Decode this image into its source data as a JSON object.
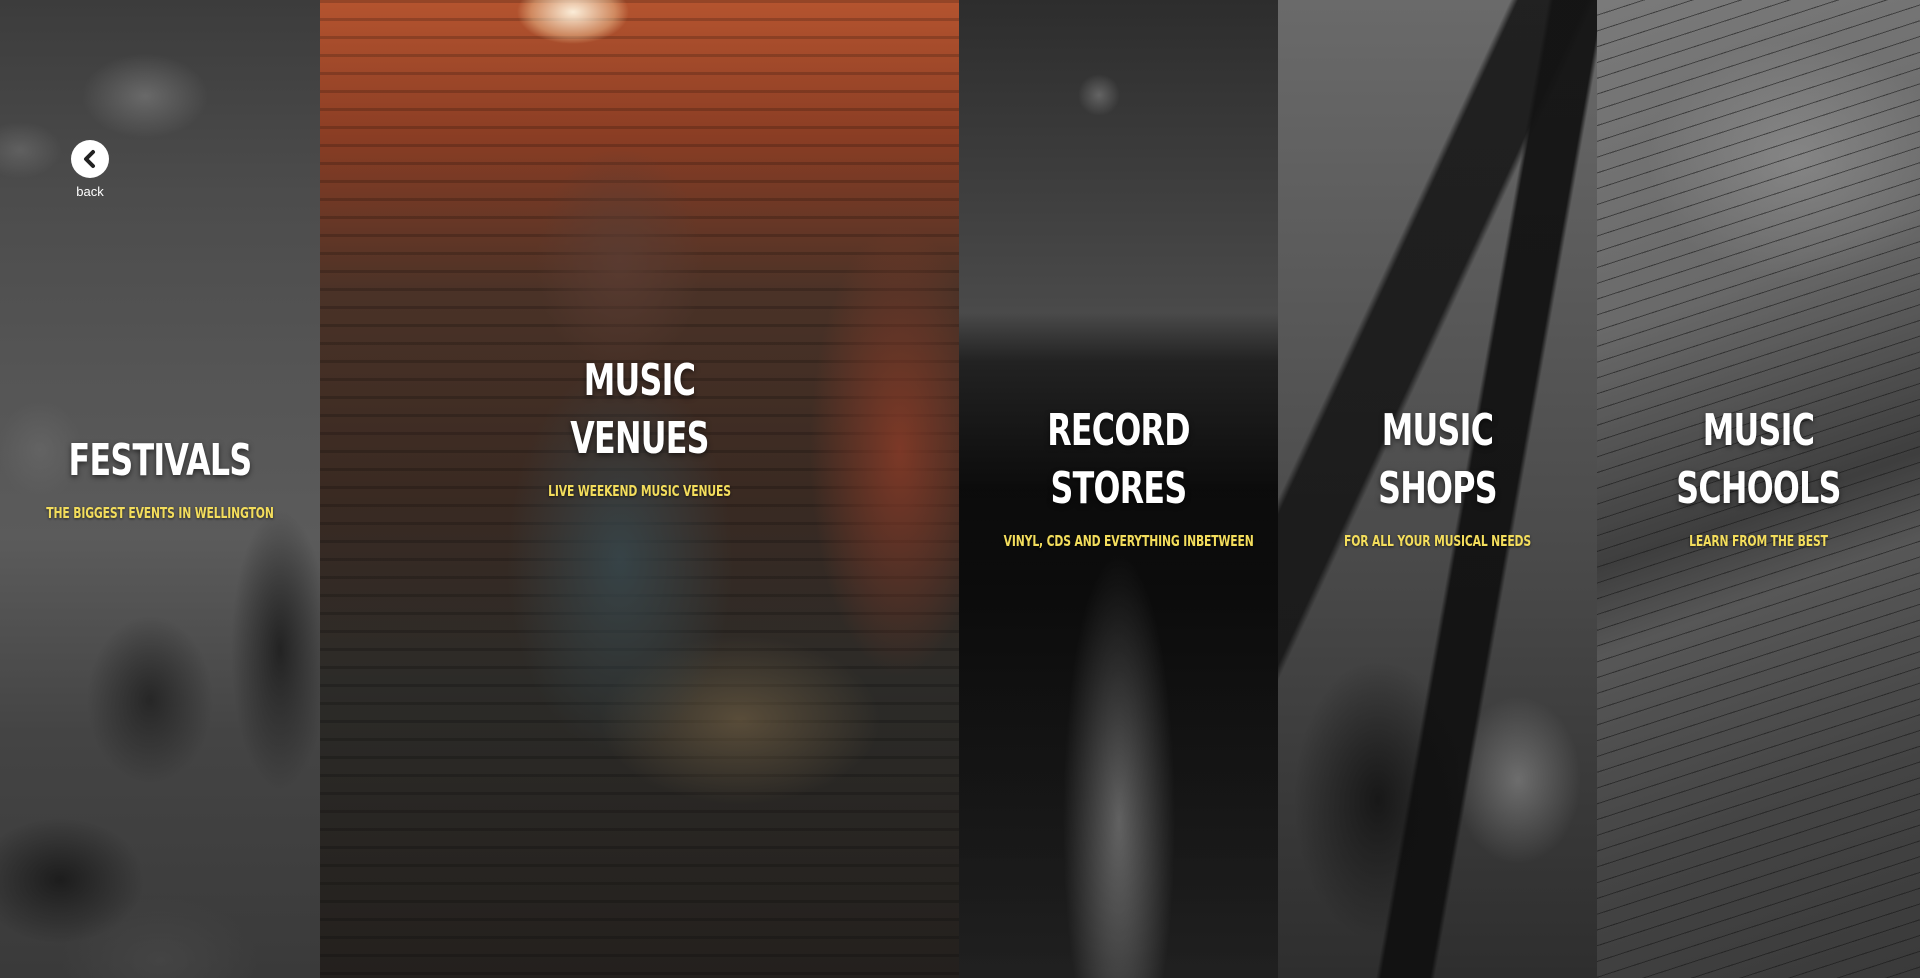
{
  "back": {
    "label": "back",
    "icon": "chevron-left-icon"
  },
  "colors": {
    "title": "#ffffff",
    "subtitle": "#f3dd5c"
  },
  "panels": [
    {
      "title_lines": [
        "FESTIVALS"
      ],
      "subtitle": "THE BIGGEST EVENTS IN WELLINGTON"
    },
    {
      "title_lines": [
        "MUSIC",
        "VENUES"
      ],
      "subtitle": "LIVE WEEKEND MUSIC VENUES"
    },
    {
      "title_lines": [
        "RECORD",
        "STORES"
      ],
      "subtitle": "VINYL, CDS AND EVERYTHING INBETWEEN"
    },
    {
      "title_lines": [
        "MUSIC",
        "SHOPS"
      ],
      "subtitle": "FOR ALL YOUR MUSICAL NEEDS"
    },
    {
      "title_lines": [
        "MUSIC",
        "SCHOOLS"
      ],
      "subtitle": "LEARN FROM THE BEST"
    }
  ]
}
